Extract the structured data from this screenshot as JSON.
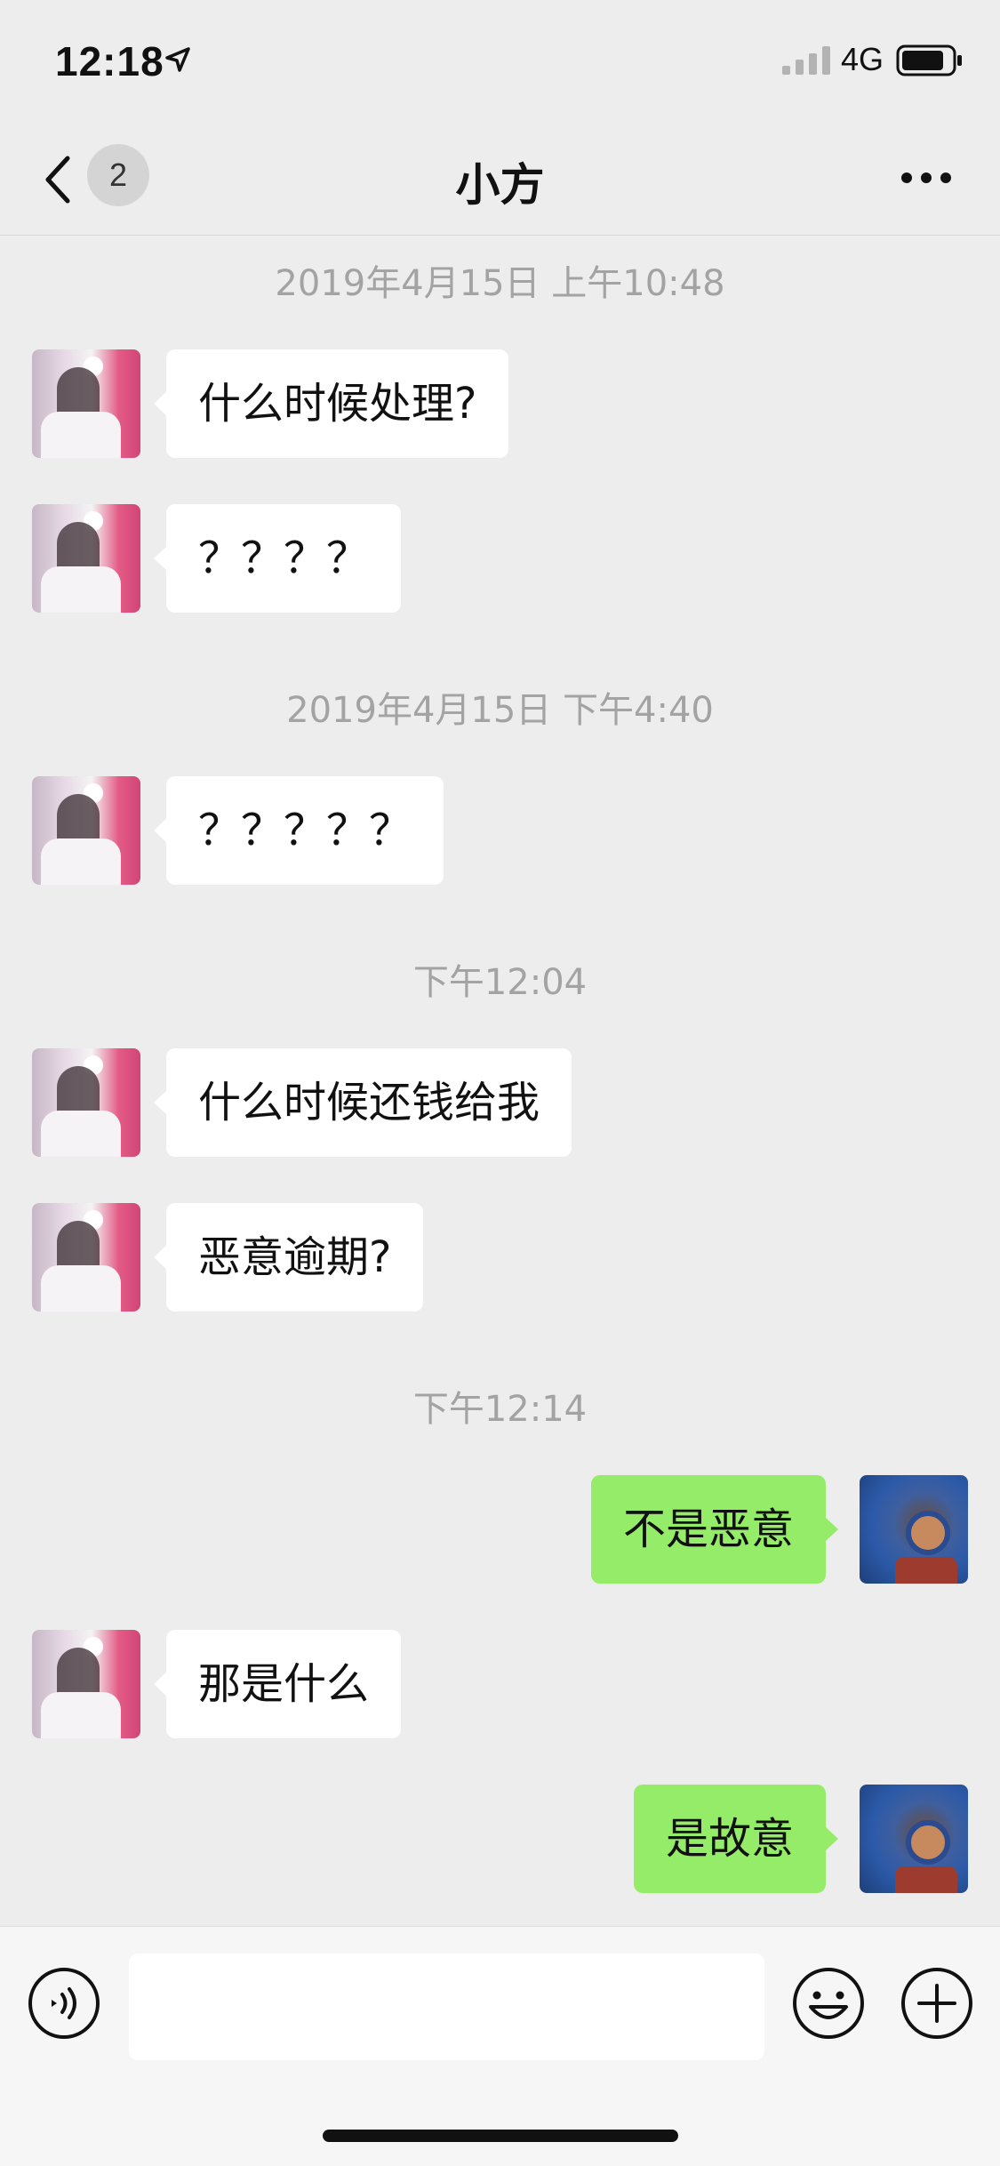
{
  "status_bar": {
    "time": "12:18",
    "network": "4G",
    "icons": [
      "location-arrow-icon",
      "signal-icon",
      "battery-icon"
    ]
  },
  "nav": {
    "back_icon": "chevron-left-icon",
    "unread_count": "2",
    "title": "小方",
    "more_icon": "more-dots-icon"
  },
  "chat": {
    "timestamps": [
      "2019年4月15日 上午10:48",
      "2019年4月15日 下午4:40",
      "下午12:04",
      "下午12:14"
    ],
    "messages": [
      {
        "from": "contact",
        "text": "什么时候处理?"
      },
      {
        "from": "contact",
        "text": "？？？？"
      },
      {
        "from": "contact",
        "text": "？？？？？"
      },
      {
        "from": "contact",
        "text": "什么时候还钱给我"
      },
      {
        "from": "contact",
        "text": "恶意逾期?"
      },
      {
        "from": "me",
        "text": "不是恶意"
      },
      {
        "from": "contact",
        "text": "那是什么"
      },
      {
        "from": "me",
        "text": "是故意"
      }
    ]
  },
  "input_bar": {
    "message_value": "",
    "icons": [
      "voice-icon",
      "emoji-icon",
      "plus-icon"
    ]
  },
  "colors": {
    "background": "#ededed",
    "incoming_bubble": "#ffffff",
    "outgoing_bubble": "#95ec69",
    "timestamp_text": "#a3a3a3"
  }
}
